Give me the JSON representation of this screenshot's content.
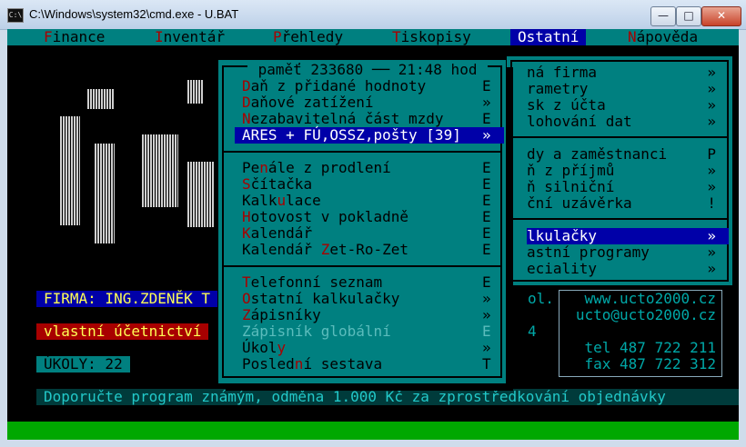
{
  "window": {
    "title": "C:\\Windows\\system32\\cmd.exe - U.BAT",
    "minimize": "—",
    "maximize": "□",
    "close": "✕",
    "icon": "cmd-icon"
  },
  "menubar": [
    {
      "hk": "F",
      "rest": "inance"
    },
    {
      "hk": "I",
      "rest": "nventář"
    },
    {
      "hk": "P",
      "rest": "řehledy"
    },
    {
      "hk": "T",
      "rest": "iskopisy"
    },
    {
      "hk": "O",
      "rest": "statní"
    },
    {
      "hk": "N",
      "rest": "ápověda"
    }
  ],
  "popup": {
    "header": " paměť 233680 ── 21:48 hod ",
    "groups": [
      [
        {
          "pre": "",
          "hk": "D",
          "post": "aň z přidané hodnoty",
          "key": "E"
        },
        {
          "pre": "",
          "hk": "D",
          "post": "aňové zatížení",
          "key": "»"
        },
        {
          "pre": "",
          "hk": "N",
          "post": "ezabavitelná část mzdy",
          "key": "E"
        },
        {
          "pre": "",
          "hk": "A",
          "post": "RES + FÚ,OSSZ,pošty [39]",
          "key": "»"
        }
      ],
      [
        {
          "pre": "Pe",
          "hk": "n",
          "post": "ále z prodlení",
          "key": "E"
        },
        {
          "pre": "",
          "hk": "S",
          "post": "čítačka",
          "key": "E"
        },
        {
          "pre": "Kalk",
          "hk": "u",
          "post": "lace",
          "key": "E"
        },
        {
          "pre": "",
          "hk": "H",
          "post": "otovost v pokladně",
          "key": "E"
        },
        {
          "pre": "",
          "hk": "K",
          "post": "alendář",
          "key": "E"
        },
        {
          "pre": "Kalendář ",
          "hk": "Z",
          "post": "et-Ro-Zet",
          "key": "E"
        }
      ],
      [
        {
          "pre": "",
          "hk": "T",
          "post": "elefonní seznam",
          "key": "E"
        },
        {
          "pre": "",
          "hk": "O",
          "post": "statní kalkulačky",
          "key": "»"
        },
        {
          "pre": "",
          "hk": "Z",
          "post": "ápisníky",
          "key": "»"
        },
        {
          "pre": "",
          "hk": "Z",
          "post": "ápisník globální",
          "key": "E"
        },
        {
          "pre": "Úkol",
          "hk": "y",
          "post": "",
          "key": "»"
        },
        {
          "pre": "Posled",
          "hk": "n",
          "post": "í sestava",
          "key": "T"
        }
      ]
    ]
  },
  "right_menu": [
    {
      "label": "ná firma",
      "key": "»"
    },
    {
      "label": "rametry",
      "key": "»"
    },
    {
      "label": "sk z účta",
      "key": "»"
    },
    {
      "label": "lohování dat",
      "key": "»"
    },
    {
      "label": "dy a zaměstnanci",
      "key": "P"
    },
    {
      "label": "ň z příjmů",
      "key": "»"
    },
    {
      "label": "ň silniční",
      "key": "»"
    },
    {
      "label": "ční uzávěrka",
      "key": "!"
    },
    {
      "label": "lkulačky",
      "key": "»"
    },
    {
      "label": "astní programy",
      "key": "»"
    },
    {
      "label": "eciality",
      "key": "»"
    }
  ],
  "status": {
    "firma": "FIRMA: ING.ZDENĚK T",
    "vlastni": "vlastní účetnictví",
    "ukoly": "ÚKOLY: 22",
    "fragment_ol": "ol.",
    "fragment_4": "4"
  },
  "contact": {
    "web": "www.ucto2000.cz",
    "email": "ucto@ucto2000.cz",
    "tel": "tel 487 722 211",
    "fax": "fax 487 722 312"
  },
  "bottom_message": "Doporučte program známým, odměna 1.000 Kč za zprostředkování objednávky",
  "colors": {
    "console_bg": "#000000",
    "menu_bg": "#008080",
    "highlight": "#0000a8",
    "hotkey": "#a80000",
    "text_yellow": "#ffff55",
    "status_green": "#00a800"
  }
}
